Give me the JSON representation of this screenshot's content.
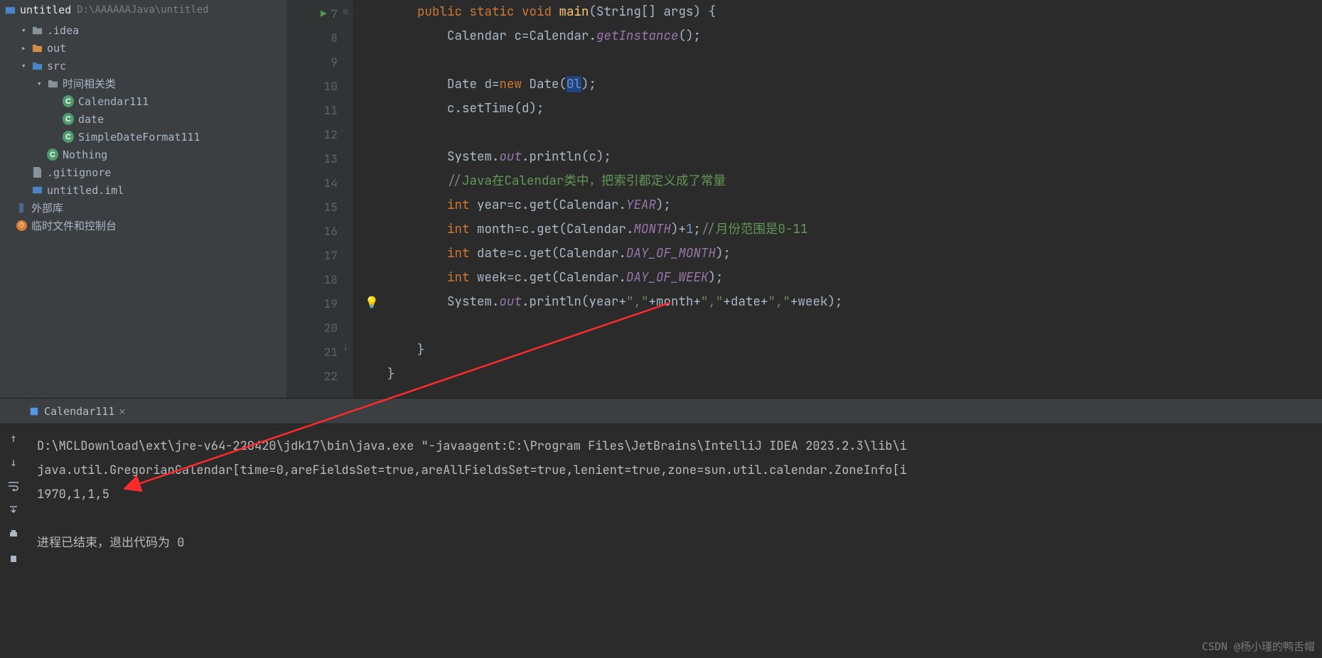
{
  "project": {
    "name": "untitled",
    "path": "D:\\AAAAAAJava\\untitled",
    "tree": [
      {
        "indent": 1,
        "chev": "v",
        "icon": "folder",
        "label": ".idea"
      },
      {
        "indent": 1,
        "chev": ">",
        "icon": "folder-orange",
        "label": "out"
      },
      {
        "indent": 1,
        "chev": "v",
        "icon": "folder-blue",
        "label": "src"
      },
      {
        "indent": 2,
        "chev": "v",
        "icon": "folder",
        "label": "时间相关类"
      },
      {
        "indent": 3,
        "chev": "",
        "icon": "class",
        "label": "Calendar111"
      },
      {
        "indent": 3,
        "chev": "",
        "icon": "class",
        "label": "date"
      },
      {
        "indent": 3,
        "chev": "",
        "icon": "class",
        "label": "SimpleDateFormat111"
      },
      {
        "indent": 2,
        "chev": "",
        "icon": "class",
        "label": "Nothing"
      },
      {
        "indent": 1,
        "chev": "",
        "icon": "file",
        "label": ".gitignore"
      },
      {
        "indent": 1,
        "chev": "",
        "icon": "module",
        "label": "untitled.iml"
      },
      {
        "indent": 0,
        "chev": "",
        "icon": "lib",
        "label": "外部库"
      },
      {
        "indent": 0,
        "chev": "",
        "icon": "scratch",
        "label": "临时文件和控制台"
      }
    ]
  },
  "editor": {
    "lines": [
      {
        "n": 7,
        "html": "        <span class='kw'>public static void</span> <span class='fn'>main</span>(String[] args) {"
      },
      {
        "n": 8,
        "html": "            Calendar c=Calendar.<span class='s-it'>getInstance</span>();"
      },
      {
        "n": 9,
        "html": ""
      },
      {
        "n": 10,
        "html": "            Date d=<span class='kw'>new</span> Date(<span class='sel'><span class='num'>0l</span></span>);"
      },
      {
        "n": 11,
        "html": "            c.setTime(d);"
      },
      {
        "n": 12,
        "html": ""
      },
      {
        "n": 13,
        "html": "            System.<span class='s-it'>out</span>.println(c);"
      },
      {
        "n": 14,
        "html": "            <span class='com'>//</span><span class='com-cn'>Java在Calendar类中，把索引都定义成了常量</span>"
      },
      {
        "n": 15,
        "html": "            <span class='kw'>int</span> year=c.get(Calendar.<span class='s-it'>YEAR</span>);"
      },
      {
        "n": 16,
        "html": "            <span class='kw'>int</span> month=c.get(Calendar.<span class='s-it'>MONTH</span>)+<span class='num'>1</span>;<span class='com'>//</span><span class='com-cn'>月份范围是0-11</span>"
      },
      {
        "n": 17,
        "html": "            <span class='kw'>int</span> date=c.get(Calendar.<span class='s-it'>DAY_OF_MONTH</span>);"
      },
      {
        "n": 18,
        "html": "            <span class='kw'>int</span> week=c.get(Calendar.<span class='s-it'>DAY_OF_WEEK</span>);"
      },
      {
        "n": 19,
        "html": "            System.<span class='s-it'>out</span>.println(year+<span class='str'>\",\"</span>+month+<span class='str'>\",\"</span>+date+<span class='str'>\",\"</span>+week);",
        "current": true
      },
      {
        "n": 20,
        "html": ""
      },
      {
        "n": 21,
        "html": "        }"
      },
      {
        "n": 22,
        "html": "    }"
      }
    ]
  },
  "run": {
    "tab": "Calendar111",
    "output": [
      "D:\\MCLDownload\\ext\\jre-v64-220420\\jdk17\\bin\\java.exe \"-javaagent:C:\\Program Files\\JetBrains\\IntelliJ IDEA 2023.2.3\\lib\\i",
      "java.util.GregorianCalendar[time=0,areFieldsSet=true,areAllFieldsSet=true,lenient=true,zone=sun.util.calendar.ZoneInfo[i",
      "1970,1,1,5",
      "",
      "进程已结束，退出代码为 0"
    ]
  },
  "watermark": "CSDN @杨小瑾的鸭舌帽"
}
